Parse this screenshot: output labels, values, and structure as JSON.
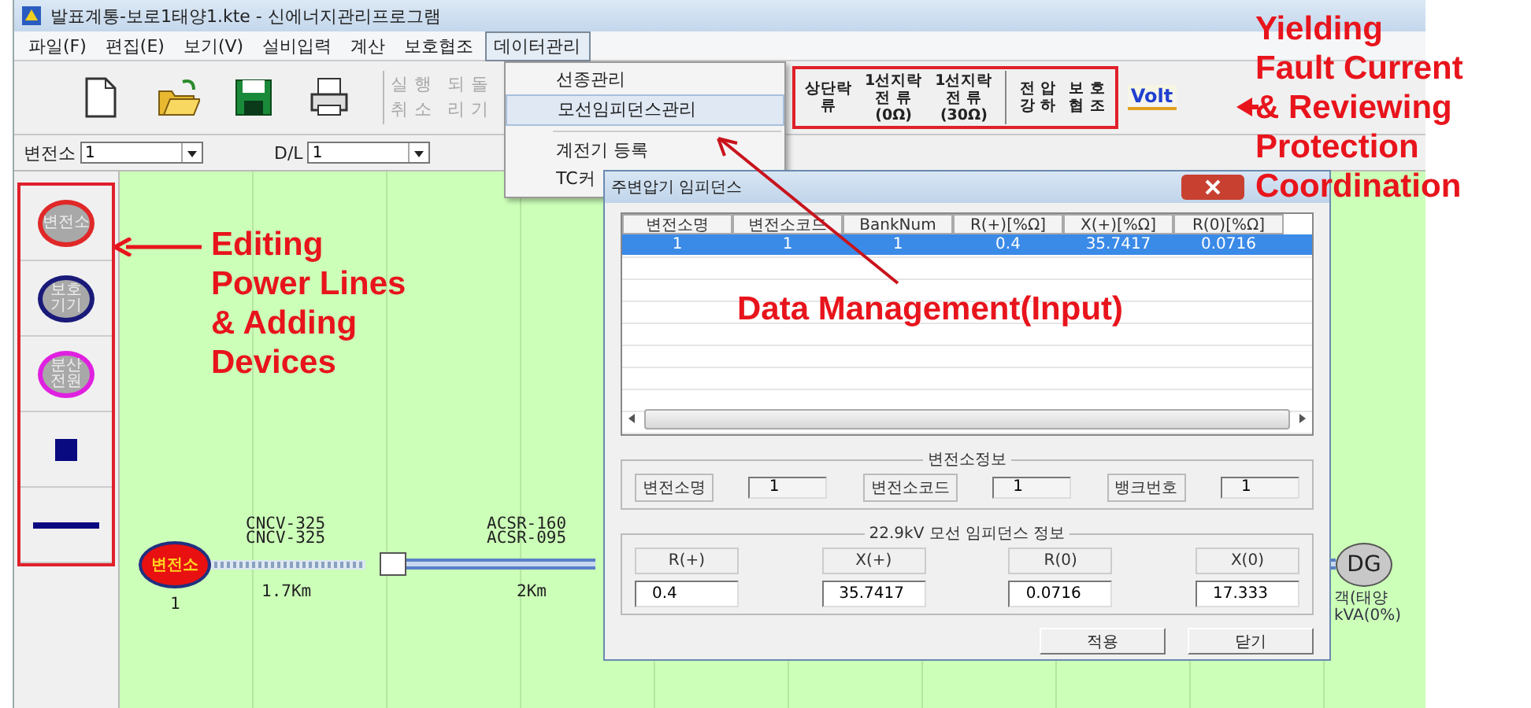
{
  "window": {
    "title": "발표계통-보로1태양1.kte - 신에너지관리프로그램"
  },
  "menu": [
    {
      "label": "파일(F)",
      "selected": false
    },
    {
      "label": "편집(E)",
      "selected": false
    },
    {
      "label": "보기(V)",
      "selected": false
    },
    {
      "label": "설비입력",
      "selected": false
    },
    {
      "label": "계산",
      "selected": false
    },
    {
      "label": "보호협조",
      "selected": false
    },
    {
      "label": "데이터관리",
      "selected": true
    }
  ],
  "toolbar": {
    "edit_buttons": [
      {
        "label": "실행취소",
        "disabled": true
      },
      {
        "label": "되돌리기",
        "disabled": true
      }
    ],
    "analysis_buttons": [
      {
        "lines": [
          "상단락",
          "류"
        ]
      },
      {
        "lines": [
          "1선지락",
          "전 류",
          "(0Ω)"
        ]
      },
      {
        "lines": [
          "1선지락",
          "전 류",
          "(30Ω)"
        ]
      },
      {
        "lines": [
          "전 압",
          "강 하"
        ]
      },
      {
        "lines": [
          "보 호",
          "협 조"
        ]
      }
    ],
    "volt_button": "Volt"
  },
  "selectors": [
    {
      "label": "변전소",
      "value": "1"
    },
    {
      "label": "D/L",
      "value": "1"
    }
  ],
  "data_menu": [
    {
      "kind": "item",
      "label": "선종관리",
      "selected": false
    },
    {
      "kind": "item",
      "label": "모선임피던스관리",
      "selected": true
    },
    {
      "kind": "separator"
    },
    {
      "kind": "item",
      "label": "계전기 등록",
      "selected": false
    },
    {
      "kind": "item",
      "label": "TC커",
      "selected": false
    }
  ],
  "palette": [
    {
      "kind": "circle",
      "lines": [
        "변전소"
      ],
      "color": "#e02828"
    },
    {
      "kind": "circle",
      "lines": [
        "보호",
        "기기"
      ],
      "color": "#1a1a7a"
    },
    {
      "kind": "circle",
      "lines": [
        "분산",
        "전원"
      ],
      "color": "#e020e0"
    },
    {
      "kind": "square",
      "color": "#0a0a80"
    },
    {
      "kind": "line",
      "color": "#0a0a80"
    }
  ],
  "diagram": {
    "substation": {
      "label": "변전소",
      "number": "1"
    },
    "segments": [
      {
        "cables": [
          "CNCV-325",
          "CNCV-325"
        ],
        "length": "1.7Km"
      },
      {
        "cables": [
          "ACSR-160",
          "ACSR-095"
        ],
        "length": "2Km"
      }
    ],
    "dg": {
      "label": "DG",
      "captions": [
        "객(태양",
        "kVA(0%)"
      ]
    }
  },
  "dialog": {
    "title": "주변압기 임피던스",
    "table": {
      "columns": [
        "변전소명",
        "변전소코드",
        "BankNum",
        "R(+)[%Ω]",
        "X(+)[%Ω]",
        "R(0)[%Ω]"
      ],
      "rows": [
        {
          "cells": [
            "1",
            "1",
            "1",
            "0.4",
            "35.7417",
            "0.0716"
          ],
          "selected": true
        }
      ]
    },
    "station_info": {
      "title": "변전소정보",
      "fields": [
        {
          "label": "변전소명",
          "value": "1"
        },
        {
          "label": "변전소코드",
          "value": "1"
        },
        {
          "label": "뱅크번호",
          "value": "1"
        }
      ]
    },
    "impedance_info": {
      "title": "22.9kV 모선 임피던스 정보",
      "fields": [
        {
          "label": "R(+)",
          "value": "0.4"
        },
        {
          "label": "X(+)",
          "value": "35.7417"
        },
        {
          "label": "R(0)",
          "value": "0.0716"
        },
        {
          "label": "X(0)",
          "value": "17.333"
        }
      ]
    },
    "buttons": [
      "적용",
      "닫기"
    ]
  },
  "annotations": [
    {
      "kind": "toolbar",
      "text": "Yielding\nFault Current\n& Reviewing\nProtection\nCoordination"
    },
    {
      "kind": "palette",
      "text": "Editing\nPower Lines\n& Adding\nDevices"
    },
    {
      "kind": "menu",
      "text": "Data Management(Input)"
    }
  ]
}
